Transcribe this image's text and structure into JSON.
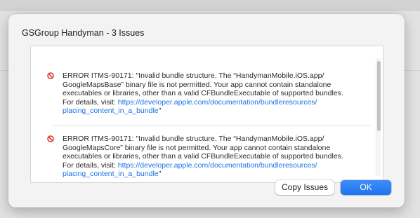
{
  "dialog": {
    "title": "GSGroup Handyman - 3 Issues"
  },
  "issues": [
    {
      "icon": "error-icon",
      "lines": [
        "ERROR ITMS-90171: \"Invalid bundle structure. The “HandymanMobile.iOS.app/",
        "GoogleMapsBase” binary file is not permitted. Your app cannot contain standalone",
        "executables or libraries, other than a valid CFBundleExecutable of supported bundles.",
        "For details, visit: "
      ],
      "link_line1": "https://developer.apple.com/documentation/bundleresources/",
      "link_line2": "placing_content_in_a_bundle",
      "tail": "\""
    },
    {
      "icon": "error-icon",
      "lines": [
        "ERROR ITMS-90171: \"Invalid bundle structure. The “HandymanMobile.iOS.app/",
        "GoogleMapsCore” binary file is not permitted. Your app cannot contain standalone",
        "executables or libraries, other than a valid CFBundleExecutable of supported bundles.",
        "For details, visit: "
      ],
      "link_line1": "https://developer.apple.com/documentation/bundleresources/",
      "link_line2": "placing_content_in_a_bundle",
      "tail": "\""
    }
  ],
  "buttons": {
    "copy_issues": "Copy Issues",
    "ok": "OK"
  },
  "colors": {
    "error_icon": "#e0302a",
    "link": "#1a73e8",
    "primary_button": "#2a7ff3"
  }
}
